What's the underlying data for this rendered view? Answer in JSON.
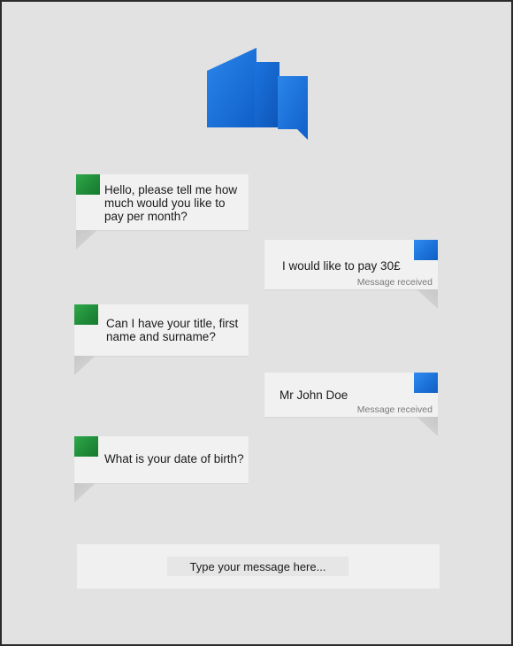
{
  "app": {
    "logo_icon": "chat-bubbles-icon",
    "bot_accent": "#1f8a38",
    "user_accent": "#1a6fd6"
  },
  "messages": [
    {
      "sender": "bot",
      "text": "Hello, please tell me how much would you like to pay per month?"
    },
    {
      "sender": "user",
      "text": "I would like to pay 30£",
      "status": "Message received"
    },
    {
      "sender": "bot",
      "text": "Can I have your title, first name and surname?"
    },
    {
      "sender": "user",
      "text": "Mr John Doe",
      "status": "Message received"
    },
    {
      "sender": "bot",
      "text": "What is your date of birth?"
    }
  ],
  "composer": {
    "placeholder": "Type your message here..."
  }
}
